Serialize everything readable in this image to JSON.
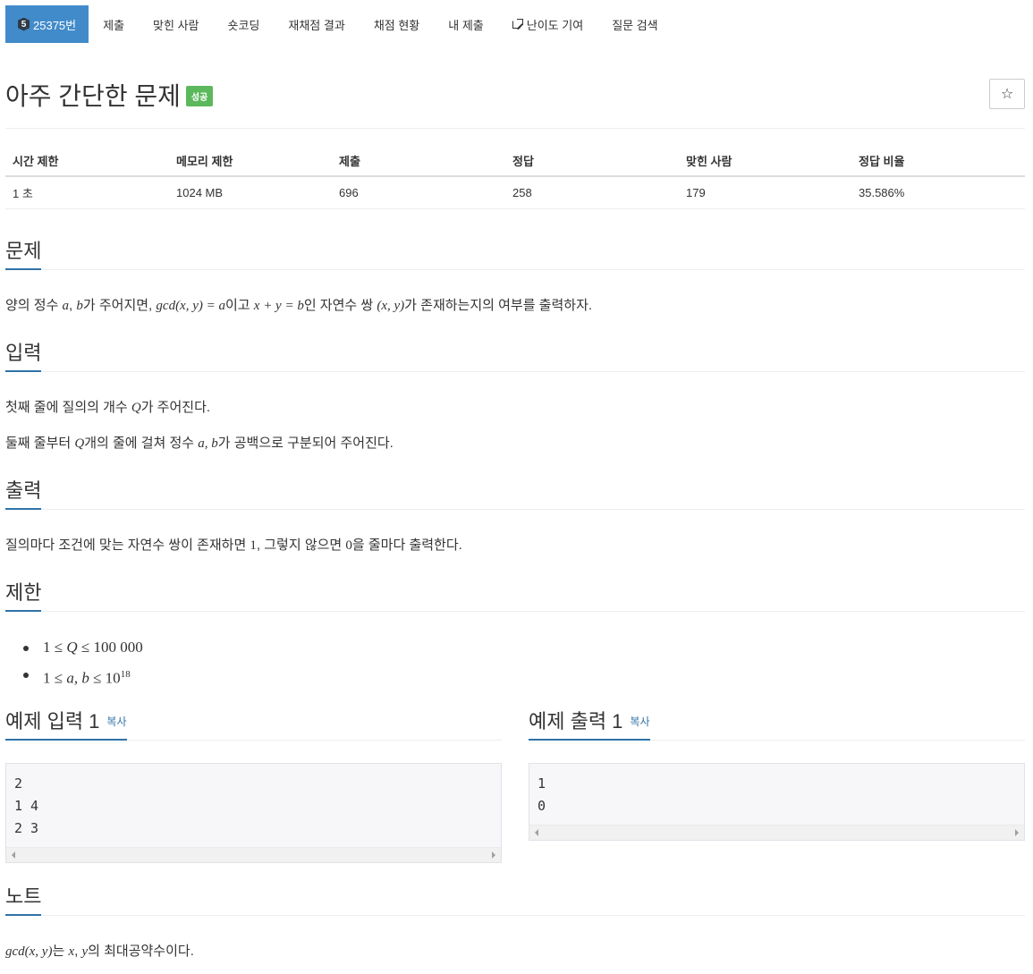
{
  "tabs": [
    {
      "label": "25375번",
      "tier": "5",
      "active": true
    },
    {
      "label": "제출"
    },
    {
      "label": "맞힌 사람"
    },
    {
      "label": "숏코딩"
    },
    {
      "label": "재채점 결과"
    },
    {
      "label": "채점 현황"
    },
    {
      "label": "내 제출"
    },
    {
      "label": "난이도 기여",
      "icon": "external-link-icon"
    },
    {
      "label": "질문 검색"
    }
  ],
  "problem": {
    "title": "아주 간단한 문제",
    "result_badge": "성공",
    "star": "☆"
  },
  "info_table": {
    "headers": [
      "시간 제한",
      "메모리 제한",
      "제출",
      "정답",
      "맞힌 사람",
      "정답 비율"
    ],
    "values": [
      "1 초",
      "1024 MB",
      "696",
      "258",
      "179",
      "35.586%"
    ]
  },
  "sections": {
    "description": {
      "heading": "문제",
      "t1": "양의 정수 ",
      "m1": "a",
      "t2": ", ",
      "m2": "b",
      "t3": "가 주어지면, ",
      "m3": "gcd(x, y) = a",
      "t4": "이고 ",
      "m4": "x + y = b",
      "t5": "인 자연수 쌍 ",
      "m5": "(x, y)",
      "t6": "가 존재하는지의 여부를 출력하자."
    },
    "input": {
      "heading": "입력",
      "line1": {
        "t1": "첫째 줄에 질의의 개수 ",
        "m1": "Q",
        "t2": "가 주어진다."
      },
      "line2": {
        "t1": "둘째 줄부터 ",
        "m1": "Q",
        "t2": "개의 줄에 걸쳐 정수 ",
        "m2": "a, b",
        "t3": "가 공백으로 구분되어 주어진다."
      }
    },
    "output": {
      "heading": "출력",
      "t1": "질의마다 조건에 맞는 자연수 쌍이 존재하면 ",
      "m1": "1",
      "t2": ", 그렇지 않으면 ",
      "m2": "0",
      "t3": "을 줄마다 출력한다."
    },
    "limits": {
      "heading": "제한",
      "l1": {
        "a": "1 ≤ ",
        "b": "Q",
        "c": " ≤ 100 000"
      },
      "l2": {
        "a": "1 ≤ ",
        "b": "a, b",
        "c": " ≤ 10",
        "sup": "18"
      }
    },
    "sample_input": {
      "heading": "예제 입력 1",
      "copy": "복사",
      "content": "2\n1 4\n2 3"
    },
    "sample_output": {
      "heading": "예제 출력 1",
      "copy": "복사",
      "content": "1\n0"
    },
    "note": {
      "heading": "노트",
      "m1": "gcd(x, y)",
      "t1": "는 ",
      "m2": "x",
      "t2": ", ",
      "m3": "y",
      "t3": "의 최대공약수이다."
    }
  },
  "colors": {
    "tab_active": "#428bca",
    "heading_underline": "#2f73a8",
    "success": "#5cb85c"
  }
}
